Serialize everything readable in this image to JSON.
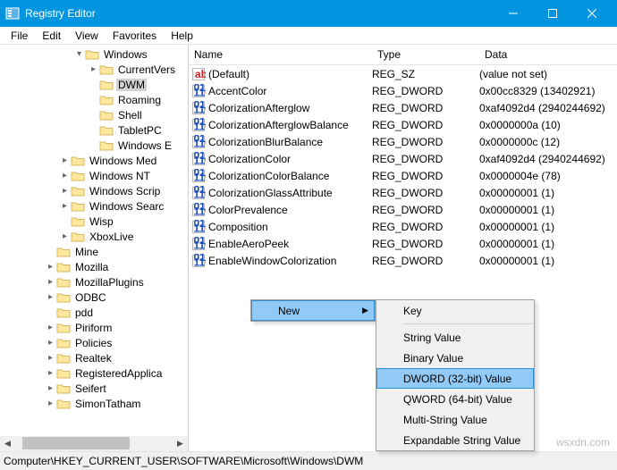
{
  "window": {
    "title": "Registry Editor"
  },
  "menus": {
    "file": "File",
    "edit": "Edit",
    "view": "View",
    "favorites": "Favorites",
    "help": "Help"
  },
  "tree": [
    {
      "indent": 82,
      "tog": "▾",
      "label": "Windows"
    },
    {
      "indent": 98,
      "tog": "▸",
      "label": "CurrentVers"
    },
    {
      "indent": 98,
      "tog": "",
      "label": "DWM",
      "selected": true
    },
    {
      "indent": 98,
      "tog": "",
      "label": "Roaming"
    },
    {
      "indent": 98,
      "tog": "",
      "label": "Shell"
    },
    {
      "indent": 98,
      "tog": "",
      "label": "TabletPC"
    },
    {
      "indent": 98,
      "tog": "",
      "label": "Windows E"
    },
    {
      "indent": 66,
      "tog": "▸",
      "label": "Windows Med"
    },
    {
      "indent": 66,
      "tog": "▸",
      "label": "Windows NT"
    },
    {
      "indent": 66,
      "tog": "▸",
      "label": "Windows Scrip"
    },
    {
      "indent": 66,
      "tog": "▸",
      "label": "Windows Searc"
    },
    {
      "indent": 66,
      "tog": "",
      "label": "Wisp"
    },
    {
      "indent": 66,
      "tog": "▸",
      "label": "XboxLive"
    },
    {
      "indent": 50,
      "tog": "",
      "label": "Mine"
    },
    {
      "indent": 50,
      "tog": "▸",
      "label": "Mozilla"
    },
    {
      "indent": 50,
      "tog": "▸",
      "label": "MozillaPlugins"
    },
    {
      "indent": 50,
      "tog": "▸",
      "label": "ODBC"
    },
    {
      "indent": 50,
      "tog": "",
      "label": "pdd"
    },
    {
      "indent": 50,
      "tog": "▸",
      "label": "Piriform"
    },
    {
      "indent": 50,
      "tog": "▸",
      "label": "Policies"
    },
    {
      "indent": 50,
      "tog": "▸",
      "label": "Realtek"
    },
    {
      "indent": 50,
      "tog": "▸",
      "label": "RegisteredApplica"
    },
    {
      "indent": 50,
      "tog": "▸",
      "label": "Seifert"
    },
    {
      "indent": 50,
      "tog": "▸",
      "label": "SimonTatham"
    }
  ],
  "columns": {
    "name": "Name",
    "type": "Type",
    "data": "Data"
  },
  "rows": [
    {
      "icon": "string",
      "name": "(Default)",
      "type": "REG_SZ",
      "data": "(value not set)"
    },
    {
      "icon": "binary",
      "name": "AccentColor",
      "type": "REG_DWORD",
      "data": "0x00cc8329 (13402921)"
    },
    {
      "icon": "binary",
      "name": "ColorizationAfterglow",
      "type": "REG_DWORD",
      "data": "0xaf4092d4 (2940244692)"
    },
    {
      "icon": "binary",
      "name": "ColorizationAfterglowBalance",
      "type": "REG_DWORD",
      "data": "0x0000000a (10)"
    },
    {
      "icon": "binary",
      "name": "ColorizationBlurBalance",
      "type": "REG_DWORD",
      "data": "0x0000000c (12)"
    },
    {
      "icon": "binary",
      "name": "ColorizationColor",
      "type": "REG_DWORD",
      "data": "0xaf4092d4 (2940244692)"
    },
    {
      "icon": "binary",
      "name": "ColorizationColorBalance",
      "type": "REG_DWORD",
      "data": "0x0000004e (78)"
    },
    {
      "icon": "binary",
      "name": "ColorizationGlassAttribute",
      "type": "REG_DWORD",
      "data": "0x00000001 (1)"
    },
    {
      "icon": "binary",
      "name": "ColorPrevalence",
      "type": "REG_DWORD",
      "data": "0x00000001 (1)"
    },
    {
      "icon": "binary",
      "name": "Composition",
      "type": "REG_DWORD",
      "data": "0x00000001 (1)"
    },
    {
      "icon": "binary",
      "name": "EnableAeroPeek",
      "type": "REG_DWORD",
      "data": "0x00000001 (1)"
    },
    {
      "icon": "binary",
      "name": "EnableWindowColorization",
      "type": "REG_DWORD",
      "data": "0x00000001 (1)"
    }
  ],
  "context_new": {
    "label": "New"
  },
  "context_sub": [
    {
      "label": "Key",
      "hl": false
    },
    {
      "sep": true
    },
    {
      "label": "String Value",
      "hl": false
    },
    {
      "label": "Binary Value",
      "hl": false
    },
    {
      "label": "DWORD (32-bit) Value",
      "hl": true
    },
    {
      "label": "QWORD (64-bit) Value",
      "hl": false
    },
    {
      "label": "Multi-String Value",
      "hl": false
    },
    {
      "label": "Expandable String Value",
      "hl": false
    }
  ],
  "status": "Computer\\HKEY_CURRENT_USER\\SOFTWARE\\Microsoft\\Windows\\DWM",
  "watermark": "wsxdn.com"
}
